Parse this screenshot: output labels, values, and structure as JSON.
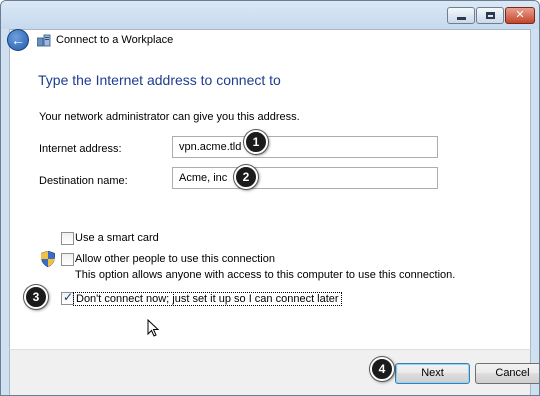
{
  "window": {
    "title": "Connect to a Workplace",
    "controls": {
      "minimize": "minimize",
      "maximize": "maximize",
      "close": "✕"
    }
  },
  "page": {
    "heading": "Type the Internet address to connect to",
    "info": "Your network administrator can give you this address."
  },
  "fields": {
    "internet_address": {
      "label": "Internet address:",
      "value": "vpn.acme.tld"
    },
    "destination_name": {
      "label": "Destination name:",
      "value": "Acme, inc"
    }
  },
  "options": {
    "smart_card": {
      "label": "Use a smart card",
      "checked": false
    },
    "allow_others": {
      "label": "Allow other people to use this connection",
      "description": "This option allows anyone with access to this computer to use this connection.",
      "checked": false
    },
    "dont_connect": {
      "label": "Don't connect now; just set it up so I can connect later",
      "checked": true
    }
  },
  "buttons": {
    "next": "Next",
    "cancel": "Cancel"
  },
  "annotations": [
    "1",
    "2",
    "3",
    "4"
  ],
  "icons": {
    "back": "back-arrow-icon",
    "wizard": "network-wizard-icon",
    "shield": "uac-shield-icon",
    "cursor": "mouse-pointer-icon"
  },
  "colors": {
    "heading": "#1e3d8f",
    "next_focus": "#3c7fb1",
    "badge": "#1b1b1b"
  }
}
